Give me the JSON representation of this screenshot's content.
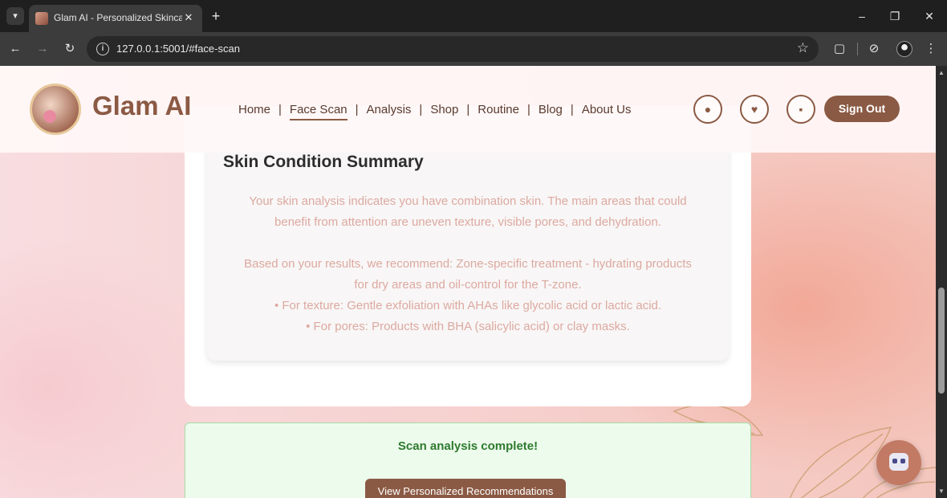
{
  "browser": {
    "tab_title": "Glam AI - Personalized Skincare",
    "tab_close": "✕",
    "new_tab": "+",
    "url": "127.0.0.1:5001/#face-scan"
  },
  "site": {
    "brand": "Glam AI",
    "nav": [
      "Home",
      "Face Scan",
      "Analysis",
      "Shop",
      "Routine",
      "Blog",
      "About Us"
    ],
    "active_nav": "Face Scan",
    "sign_out": "Sign Out"
  },
  "summary": {
    "title": "Skin Condition Summary",
    "line1": "Your skin analysis indicates you have combination skin. The main areas that could",
    "line2": "benefit from attention are uneven texture, visible pores, and dehydration.",
    "line3": "Based on your results, we recommend: Zone-specific treatment - hydrating products",
    "line4": "for dry areas and oil-control for the T-zone.",
    "line5": "• For texture: Gentle exfoliation with AHAs like glycolic acid or lactic acid.",
    "line6": "• For pores: Products with BHA (salicylic acid) or clay masks."
  },
  "status": {
    "message": "Scan analysis complete!",
    "button": "View Personalized Recommendations"
  },
  "colors": {
    "brand_brown": "#8b5a44",
    "success_green": "#2f7a2f",
    "summary_text": "#dca9a0"
  }
}
